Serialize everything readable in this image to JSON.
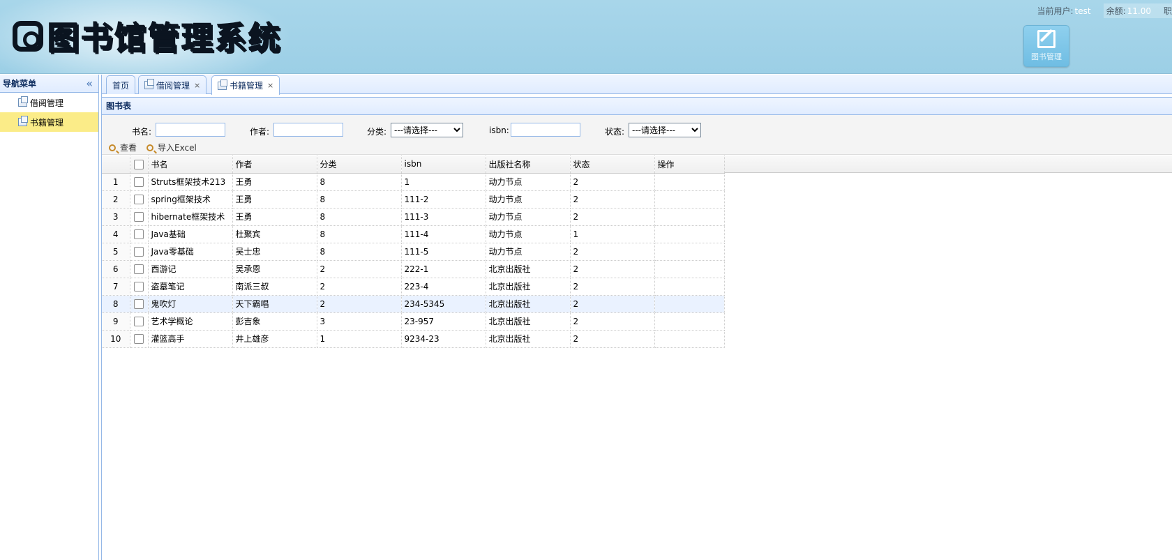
{
  "header": {
    "logo_text": "图书馆管理系统",
    "user_label": "当前用户:",
    "user_name": "test",
    "balance_label": "余额:",
    "balance_value": "11.00",
    "extra_label": "职",
    "quick_button_label": "图书管理"
  },
  "sidebar": {
    "title": "导航菜单",
    "items": [
      {
        "label": "借阅管理",
        "active": false
      },
      {
        "label": "书籍管理",
        "active": true
      }
    ]
  },
  "tabs": [
    {
      "label": "首页",
      "closable": false
    },
    {
      "label": "借阅管理",
      "closable": true
    },
    {
      "label": "书籍管理",
      "closable": true,
      "selected": true
    }
  ],
  "panel": {
    "title": "图书表"
  },
  "search": {
    "name_label": "书名:",
    "name_value": "",
    "author_label": "作者:",
    "author_value": "",
    "category_label": "分类:",
    "category_selected": "---请选择---",
    "isbn_label": "isbn:",
    "isbn_value": "",
    "status_label": "状态:",
    "status_selected": "---请选择---",
    "view_button": "查看",
    "import_button": "导入Excel"
  },
  "grid": {
    "columns": [
      "书名",
      "作者",
      "分类",
      "isbn",
      "出版社名称",
      "状态",
      "操作"
    ],
    "rows": [
      {
        "num": "1",
        "name": "Struts框架技术213",
        "author": "王勇",
        "category": "8",
        "isbn": "1",
        "publisher": "动力节点",
        "status": "2",
        "op": ""
      },
      {
        "num": "2",
        "name": "spring框架技术",
        "author": "王勇",
        "category": "8",
        "isbn": "111-2",
        "publisher": "动力节点",
        "status": "2",
        "op": ""
      },
      {
        "num": "3",
        "name": "hibernate框架技术",
        "author": "王勇",
        "category": "8",
        "isbn": "111-3",
        "publisher": "动力节点",
        "status": "2",
        "op": ""
      },
      {
        "num": "4",
        "name": "Java基础",
        "author": "杜聚宾",
        "category": "8",
        "isbn": "111-4",
        "publisher": "动力节点",
        "status": "1",
        "op": ""
      },
      {
        "num": "5",
        "name": "Java零基础",
        "author": "吴士忠",
        "category": "8",
        "isbn": "111-5",
        "publisher": "动力节点",
        "status": "2",
        "op": ""
      },
      {
        "num": "6",
        "name": "西游记",
        "author": "吴承恩",
        "category": "2",
        "isbn": "222-1",
        "publisher": "北京出版社",
        "status": "2",
        "op": ""
      },
      {
        "num": "7",
        "name": "盗墓笔记",
        "author": "南派三叔",
        "category": "2",
        "isbn": "223-4",
        "publisher": "北京出版社",
        "status": "2",
        "op": ""
      },
      {
        "num": "8",
        "name": "鬼吹灯",
        "author": "天下霸唱",
        "category": "2",
        "isbn": "234-5345",
        "publisher": "北京出版社",
        "status": "2",
        "op": ""
      },
      {
        "num": "9",
        "name": "艺术学概论",
        "author": "彭吉象",
        "category": "3",
        "isbn": "23-957",
        "publisher": "北京出版社",
        "status": "2",
        "op": ""
      },
      {
        "num": "10",
        "name": "灌篮高手",
        "author": "井上雄彦",
        "category": "1",
        "isbn": "9234-23",
        "publisher": "北京出版社",
        "status": "2",
        "op": ""
      }
    ]
  }
}
